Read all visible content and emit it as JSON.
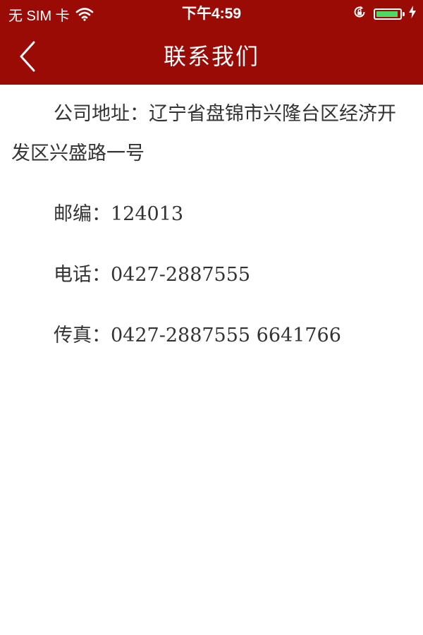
{
  "status_bar": {
    "carrier": "无 SIM 卡",
    "time": "下午4:59",
    "battery_level": 0.95,
    "icons": [
      "wifi-icon",
      "rotation-lock-icon",
      "battery-icon",
      "charging-bolt-icon"
    ]
  },
  "nav": {
    "title": "联系我们",
    "back_icon": "chevron-left-icon"
  },
  "contact": {
    "address": "公司地址：辽宁省盘锦市兴隆台区经济开发区兴盛路一号",
    "postcode": "邮编：124013",
    "phone": "电话：0427-2887555",
    "fax": "传真：0427-2887555 6641766"
  },
  "colors": {
    "header_bg": "#9b0b06",
    "text": "#333333",
    "battery": "#4cd964"
  }
}
